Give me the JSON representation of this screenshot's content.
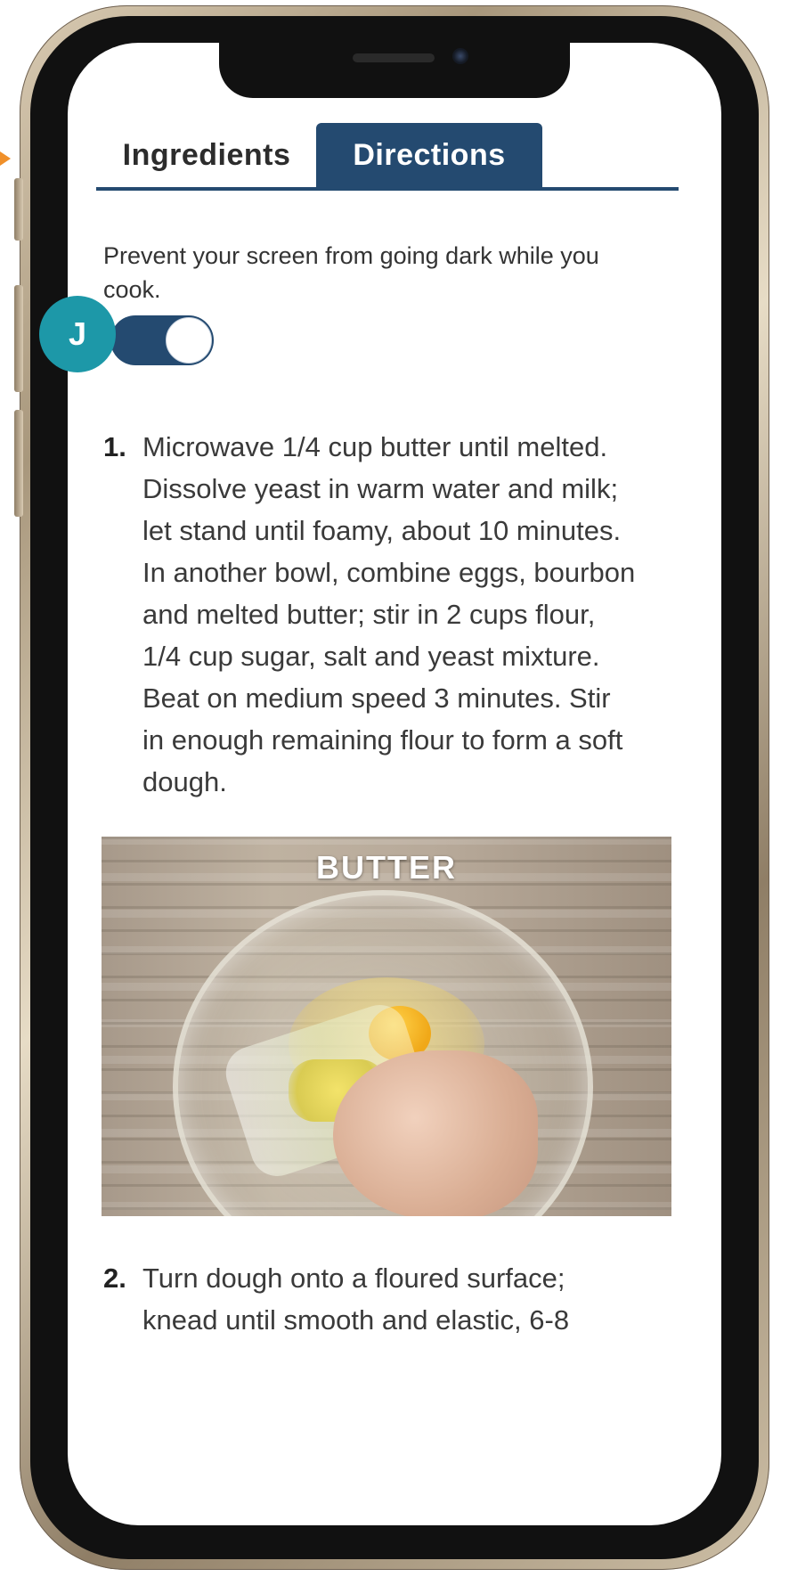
{
  "tabs": [
    {
      "label": "Ingredients",
      "active": false
    },
    {
      "label": "Directions",
      "active": true
    }
  ],
  "screen_awake": {
    "prompt": "Prevent your screen from going dark while you cook.",
    "enabled": true
  },
  "avatar": {
    "initial": "J",
    "color": "#1d98a8"
  },
  "steps": [
    {
      "number": "1.",
      "text": "Microwave 1/4 cup butter until melted. Dissolve yeast in warm water and milk; let stand until foamy, about 10 minutes. In another bowl, combine eggs, bourbon and melted butter; stir in 2 cups flour, 1/4 cup sugar, salt and yeast mixture. Beat on medium speed 3 minutes. Stir in enough remaining flour to form a soft dough.",
      "image_label": "BUTTER"
    },
    {
      "number": "2.",
      "text": "Turn dough onto a floured surface; knead until smooth and elastic, 6-8"
    }
  ],
  "colors": {
    "accent": "#244a70",
    "text": "#3a3a3a",
    "arrow": "#f0902a"
  },
  "icons": {
    "indicator": "orange-arrow-icon"
  }
}
